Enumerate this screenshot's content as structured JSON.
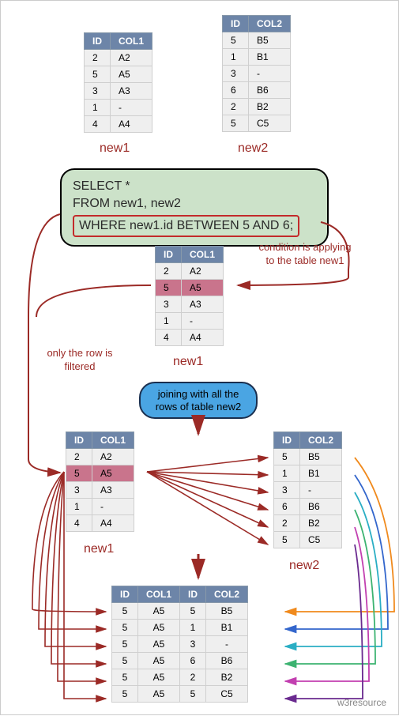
{
  "tables": {
    "top_new1": {
      "headers": [
        "ID",
        "COL1"
      ],
      "rows": [
        [
          "2",
          "A2"
        ],
        [
          "5",
          "A5"
        ],
        [
          "3",
          "A3"
        ],
        [
          "1",
          "-"
        ],
        [
          "4",
          "A4"
        ]
      ],
      "caption": "new1"
    },
    "top_new2": {
      "headers": [
        "ID",
        "COL2"
      ],
      "rows": [
        [
          "5",
          "B5"
        ],
        [
          "1",
          "B1"
        ],
        [
          "3",
          "-"
        ],
        [
          "6",
          "B6"
        ],
        [
          "2",
          "B2"
        ],
        [
          "5",
          "C5"
        ]
      ],
      "caption": "new2"
    },
    "mid_new1": {
      "headers": [
        "ID",
        "COL1"
      ],
      "rows": [
        [
          "2",
          "A2"
        ],
        [
          "5",
          "A5"
        ],
        [
          "3",
          "A3"
        ],
        [
          "1",
          "-"
        ],
        [
          "4",
          "A4"
        ]
      ],
      "highlight_index": 1,
      "caption": "new1"
    },
    "lower_new1": {
      "headers": [
        "ID",
        "COL1"
      ],
      "rows": [
        [
          "2",
          "A2"
        ],
        [
          "5",
          "A5"
        ],
        [
          "3",
          "A3"
        ],
        [
          "1",
          "-"
        ],
        [
          "4",
          "A4"
        ]
      ],
      "highlight_index": 1,
      "caption": "new1"
    },
    "lower_new2": {
      "headers": [
        "ID",
        "COL2"
      ],
      "rows": [
        [
          "5",
          "B5"
        ],
        [
          "1",
          "B1"
        ],
        [
          "3",
          "-"
        ],
        [
          "6",
          "B6"
        ],
        [
          "2",
          "B2"
        ],
        [
          "5",
          "C5"
        ]
      ],
      "caption": "new2"
    },
    "result": {
      "headers": [
        "ID",
        "COL1",
        "ID",
        "COL2"
      ],
      "rows": [
        [
          "5",
          "A5",
          "5",
          "B5"
        ],
        [
          "5",
          "A5",
          "1",
          "B1"
        ],
        [
          "5",
          "A5",
          "3",
          "-"
        ],
        [
          "5",
          "A5",
          "6",
          "B6"
        ],
        [
          "5",
          "A5",
          "2",
          "B2"
        ],
        [
          "5",
          "A5",
          "5",
          "C5"
        ]
      ]
    }
  },
  "sql": {
    "line1": "SELECT *",
    "line2": "FROM new1, new2",
    "line3": "WHERE new1.id BETWEEN 5 AND 6;"
  },
  "notes": {
    "condition": "condition is applying to the table new1",
    "filtered": "only the row is filtered",
    "joining": "joining with all the rows of table new2"
  },
  "footer": "w3resource"
}
